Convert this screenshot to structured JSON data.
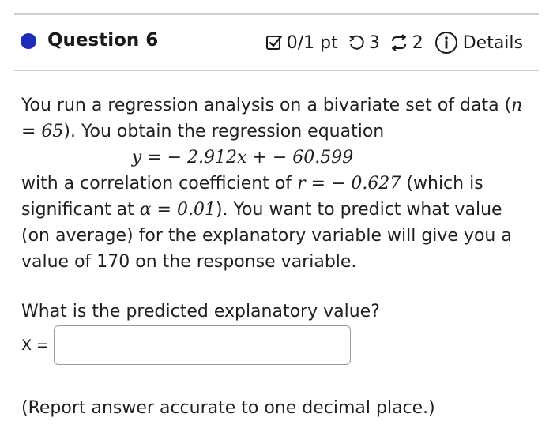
{
  "header": {
    "question_label": "Question 6",
    "score": "0/1 pt",
    "retries": "3",
    "attempts": "2",
    "details_label": "Details",
    "icons": {
      "status": "filled-circle-icon",
      "score": "checkbox-icon",
      "retry": "retry-icon",
      "attempts": "repeat-icon",
      "info": "info-icon"
    },
    "colors": {
      "status_dot": "#1c2bb8"
    }
  },
  "problem": {
    "intro_a": "You run a regression analysis on a bivariate set of data (",
    "n_eq": "n = 65",
    "intro_b": "). You obtain the regression equation",
    "equation": "y = − 2.912x + − 60.599",
    "corr_a": "with a correlation coefficient of",
    "r_eq": "r = − 0.627",
    "corr_b": "(which is significant at",
    "alpha_eq": "α = 0.01",
    "corr_c": "). You want to predict what value (on average) for the explanatory variable will give you a value of 170 on the response variable."
  },
  "prompt": "What is the predicted explanatory value?",
  "answer": {
    "label": "X =",
    "value": "",
    "placeholder": ""
  },
  "note": "(Report answer accurate to one decimal place.)"
}
